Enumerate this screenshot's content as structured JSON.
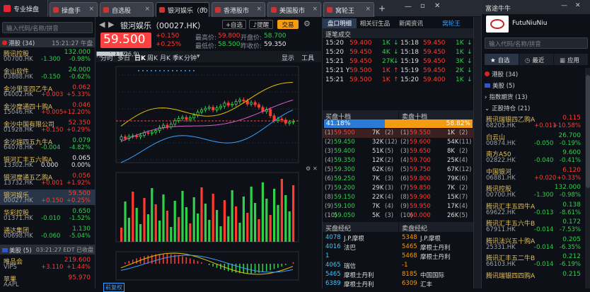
{
  "tabs": {
    "home": "专业操盘",
    "t1": "操盘手",
    "t2": "自选股",
    "t3": "银河娱乐（00",
    "t4": "香港股市",
    "t5": "美国股市",
    "t6": "窝轮王"
  },
  "left": {
    "search_placeholder": "输入代码/名称/拼音",
    "group_hk": "港股 (34)",
    "hk_time": "15:21:27 午盘",
    "group_us": "美股 (5)",
    "us_time": "03:21:27 EDT 已收盘",
    "hk_rows": [
      {
        "name": "腾讯控股",
        "price": "132.000",
        "code": "00700.HK",
        "chg": "-1.300",
        "pct": "-0.98%",
        "up": false
      },
      {
        "name": "金山软件",
        "price": "24.000",
        "code": "03888.HK",
        "chg": "-0.150",
        "pct": "-0.62%",
        "up": false
      },
      {
        "name": "金沙里亚四乙牛A",
        "price": "0.062",
        "code": "64002.HK",
        "chg": "+0.003",
        "pct": "+5.33%",
        "up": true
      },
      {
        "name": "金沙摩通四十购A",
        "price": "0.046",
        "code": "15046.HK",
        "chg": "+0.005",
        "pct": "+12.20%",
        "up": true
      },
      {
        "name": "金沙中国有限公司",
        "price": "52.350",
        "code": "01928.HK",
        "chg": "+0.150",
        "pct": "+0.29%",
        "up": true
      },
      {
        "name": "金沙瑞四五九牛A",
        "price": "0.079",
        "code": "64078.HK",
        "chg": "-0.004",
        "pct": "-4.82%",
        "up": false
      },
      {
        "name": "银河汇丰五六购A",
        "price": "0.065",
        "code": "13302.HK",
        "chg": "0.000",
        "pct": "0.00%",
        "up": null
      },
      {
        "name": "银河摩通五乙购A",
        "price": "0.056",
        "code": "13732.HK",
        "chg": "+0.001",
        "pct": "+1.92%",
        "up": true
      },
      {
        "name": "银河娱乐",
        "price": "59.500",
        "code": "00027.HK",
        "chg": "+0.150",
        "pct": "+0.25%",
        "up": true
      },
      {
        "name": "华彩控股",
        "price": "0.650",
        "code": "01371.HK",
        "chg": "-0.010",
        "pct": "-1.52%",
        "up": false
      },
      {
        "name": "通达集团",
        "price": "1.130",
        "code": "00698.HK",
        "chg": "-0.060",
        "pct": "-5.04%",
        "up": false
      }
    ],
    "us_rows": [
      {
        "name": "唯品会",
        "price": "219.600",
        "code": "VIPS",
        "chg": "+3.110",
        "pct": "+1.44%",
        "up": true
      },
      {
        "name": "苹果",
        "price": "95.970",
        "code": "AAPL",
        "chg": "",
        "pct": "",
        "up": true
      }
    ]
  },
  "quote": {
    "title": "银河娱乐（00027.HK）",
    "add_watch": "+自选",
    "alert": "提醒",
    "trade": "交易",
    "price": "59.500",
    "chg": "+0.150",
    "pct": "+0.25%",
    "high_l": "最高价:",
    "high": "59.800",
    "open_l": "开盘价:",
    "open": "58.700",
    "low_l": "最低价:",
    "low": "58.500",
    "prev_l": "昨收价:",
    "prev": "59.350",
    "tools": [
      "分时",
      "多日",
      "日K",
      "周K",
      "月K",
      "季K",
      "分钟"
    ],
    "tools_r": [
      "显示",
      "工具"
    ],
    "boll": {
      "label": "BOLL(20,2)",
      "mid": "MID:",
      "upper": "UPPE",
      "lower": "LOW"
    },
    "yaxis": [
      "68.050",
      "65.450",
      "62.850",
      "60.250",
      "57.650",
      "55.050",
      "52.450"
    ],
    "ylabels_l": [
      "68.00",
      "65.50",
      "63.00",
      "61.30",
      "58.70",
      "56.10"
    ],
    "price_tag": "59.50",
    "unit": "万",
    "vol": {
      "label": "MAVOL5:",
      "v10": "MAVOL10:",
      "v20": "MAVOL20:",
      "ticks": [
        "3580.715",
        "2983.929",
        "2387.143",
        "1790.357",
        "1193.571",
        "596.786"
      ]
    },
    "macd": {
      "label": "MACD(12,26,9)",
      "dif": "DIF:",
      "dea": "DEA:",
      "macd": "MACD:",
      "ticks": [
        "0.830",
        "0.450",
        "0.070",
        "-0.310",
        "-0.690"
      ]
    },
    "xaxis": [
      "2016/06",
      "6"
    ],
    "bottom_label": "前复权"
  },
  "orderbook": {
    "tabs": [
      "盘口明细",
      "相关衍生品",
      "新闻资讯",
      "窝轮王"
    ],
    "tick_hdr": "逐笔成交",
    "ticks_l": [
      [
        "15:20",
        "59.400",
        "1K",
        "g"
      ],
      [
        "15:20",
        "59.450",
        "4K",
        "g"
      ],
      [
        "15:21",
        "59.450",
        "27K",
        "g"
      ],
      [
        "15:21 Y",
        "59.500",
        "1K",
        "r"
      ],
      [
        "15:21",
        "59.500",
        "1K",
        "r"
      ]
    ],
    "ticks_r": [
      [
        "15:18",
        "59.450",
        "1K",
        "g"
      ],
      [
        "15:18",
        "59.450",
        "1K",
        "g"
      ],
      [
        "15:19",
        "59.450",
        "3K",
        "g"
      ],
      [
        "15:19",
        "59.450",
        "2K",
        "g"
      ],
      [
        "15:20",
        "59.400",
        "1K",
        "g"
      ]
    ],
    "bid_hdr": "买盘十档",
    "ask_hdr": "卖盘十档",
    "bid_pct": "41.18%",
    "ask_pct": "58.82%",
    "bids": [
      [
        "(1)",
        "59.500",
        "7K",
        "(2)"
      ],
      [
        "(2)",
        "59.450",
        "32K",
        "(12)"
      ],
      [
        "(3)",
        "59.400",
        "51K",
        "(5)"
      ],
      [
        "(4)",
        "59.350",
        "12K",
        "(2)"
      ],
      [
        "(5)",
        "59.300",
        "62K",
        "(6)"
      ],
      [
        "(6)",
        "59.250",
        "7K",
        "(3)"
      ],
      [
        "(7)",
        "59.200",
        "29K",
        "(3)"
      ],
      [
        "(8)",
        "59.150",
        "22K",
        "(4)"
      ],
      [
        "(9)",
        "59.100",
        "7K",
        "(4)"
      ],
      [
        "(10)",
        "59.050",
        "5K",
        "(3)"
      ]
    ],
    "asks": [
      [
        "(1)",
        "59.550",
        "1K",
        "(2)"
      ],
      [
        "(2)",
        "59.600",
        "54K",
        "(11)"
      ],
      [
        "(3)",
        "59.650",
        "8K",
        "(2)"
      ],
      [
        "(4)",
        "59.700",
        "25K",
        "(4)"
      ],
      [
        "(5)",
        "59.750",
        "67K",
        "(12)"
      ],
      [
        "(6)",
        "59.800",
        "79K",
        "(6)"
      ],
      [
        "(7)",
        "59.850",
        "7K",
        "(2)"
      ],
      [
        "(8)",
        "59.900",
        "15K",
        "(7)"
      ],
      [
        "(9)",
        "59.950",
        "17K",
        "(4)"
      ],
      [
        "(10)",
        "60.000",
        "26K",
        "(5)"
      ]
    ],
    "bq_hdr": "买盘经纪",
    "sq_hdr": "卖盘经纪",
    "bq": [
      [
        "4078",
        "J.P.摩根"
      ],
      [
        "4016",
        "法巴"
      ],
      [
        "1",
        ""
      ],
      [
        "4065",
        "瑞信"
      ],
      [
        "5465",
        "摩根士丹利"
      ],
      [
        "6389",
        "摩根士丹利"
      ]
    ],
    "sq": [
      [
        "5348",
        "J.P.摩根"
      ],
      [
        "5465",
        "摩根士丹利"
      ],
      [
        "5468",
        "摩根士丹利"
      ],
      [
        "-1",
        ""
      ],
      [
        "8185",
        "中国国际"
      ],
      [
        "6309",
        "汇丰"
      ]
    ]
  },
  "right": {
    "app": "富途牛牛",
    "user": "FutuNiuNiu",
    "search_placeholder": "输入代码/名称/拼音",
    "tabs": [
      "自选",
      "最近",
      "应用"
    ],
    "groups": {
      "hk": "港股 (34)",
      "us": "美股 (5)",
      "idx": "指数期货 (13)",
      "stocks": "正股持仓 (21)"
    },
    "rows": [
      {
        "name": "腾讯瑞银四乙购A",
        "price": "0.115",
        "code": "68205.HK",
        "chg": "+0.011",
        "pct": "+10.58%",
        "up": true
      },
      {
        "name": "白云山",
        "price": "26.700",
        "code": "00874.HK",
        "chg": "-0.050",
        "pct": "-0.19%",
        "up": false
      },
      {
        "name": "南方A50",
        "price": "9.600",
        "code": "02822.HK",
        "chg": "-0.040",
        "pct": "-0.41%",
        "up": false
      },
      {
        "name": "中国银河",
        "price": "6.120",
        "code": "06881.HK",
        "chg": "+0.020",
        "pct": "+0.33%",
        "up": true
      },
      {
        "name": "腾讯控股",
        "price": "132.000",
        "code": "00700.HK",
        "chg": "-1.300",
        "pct": "-0.98%",
        "up": false
      },
      {
        "name": "腾讯汇丰五四牛A",
        "price": "0.138",
        "code": "69622.HK",
        "chg": "-0.013",
        "pct": "-8.61%",
        "up": false
      },
      {
        "name": "腾讯汇丰五六牛B",
        "price": "0.172",
        "code": "67911.HK",
        "chg": "-0.014",
        "pct": "-7.53%",
        "up": false
      },
      {
        "name": "腾讯法兴五十购A",
        "price": "0.205",
        "code": "25331.HK",
        "chg": "-0.014",
        "pct": "-6.35%",
        "up": false
      },
      {
        "name": "腾讯汇丰五二牛B",
        "price": "0.212",
        "code": "66103.HK",
        "chg": "-0.014",
        "pct": "-6.19%",
        "up": false
      },
      {
        "name": "腾讯瑞银四四购A",
        "price": "0.215",
        "code": "",
        "chg": "",
        "pct": "",
        "up": false
      }
    ]
  }
}
